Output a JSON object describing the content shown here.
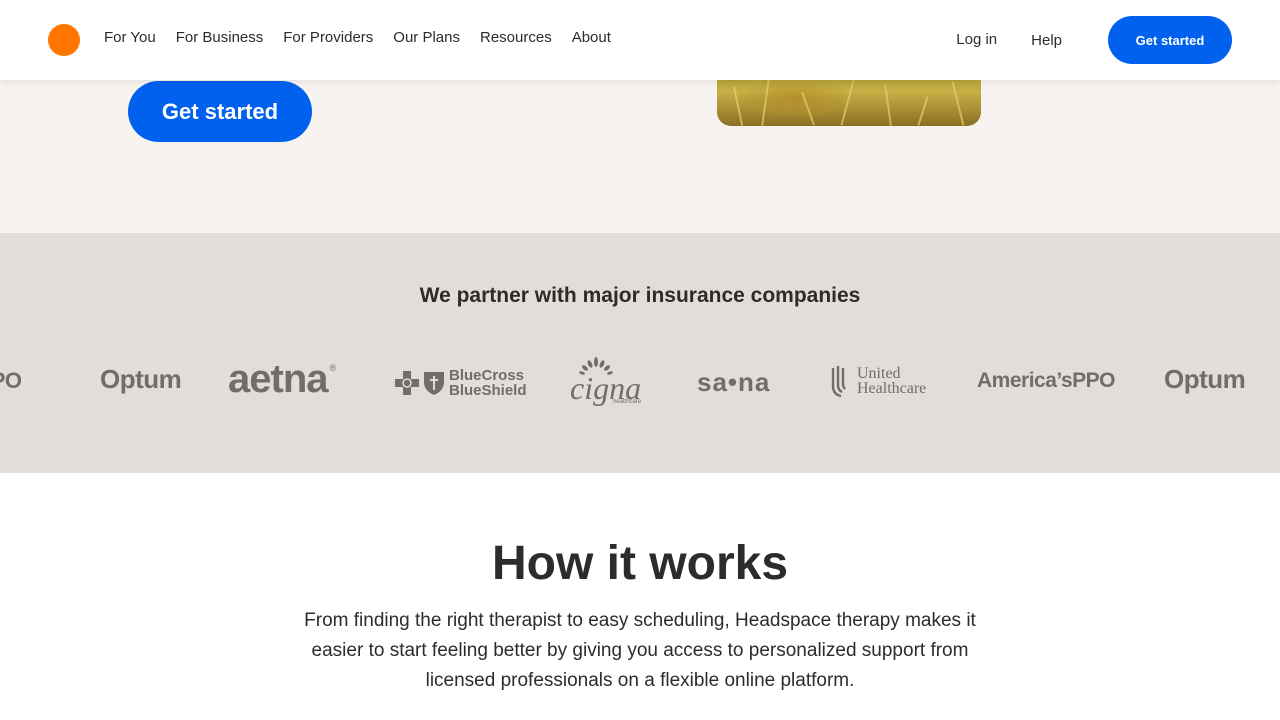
{
  "nav": {
    "links": [
      "For You",
      "For Business",
      "For Providers",
      "Our Plans",
      "Resources",
      "About"
    ],
    "login": "Log in",
    "help": "Help",
    "cta": "Get started",
    "logo_color": "#ff7500"
  },
  "hero": {
    "cta": "Get started"
  },
  "partners": {
    "title": "We partner with major insurance companies",
    "logos": {
      "americas_ppo_partial": "’sPPO",
      "optum_1": "Optum",
      "aetna": "aetna",
      "aetna_mark": "®",
      "bcbs_line1": "BlueCross",
      "bcbs_line2": "BlueShield",
      "cigna": "cigna",
      "cigna_sub": "healthcare",
      "sana": "sa•na",
      "uhc_line1": "United",
      "uhc_line2": "Healthcare",
      "americas_ppo": "America’sPPO",
      "optum_2": "Optum"
    }
  },
  "how": {
    "title": "How it works",
    "body": "From finding the right therapist to easy scheduling, Headspace therapy makes it easier to start feeling better by giving you access to personalized support from licensed professionals on a flexible online platform."
  },
  "colors": {
    "primary": "#0061ef",
    "hero_bg": "#f7f3f1",
    "partner_bg": "#e1deda",
    "text": "#2d2c2b",
    "logo_gray": "#706d6a"
  }
}
